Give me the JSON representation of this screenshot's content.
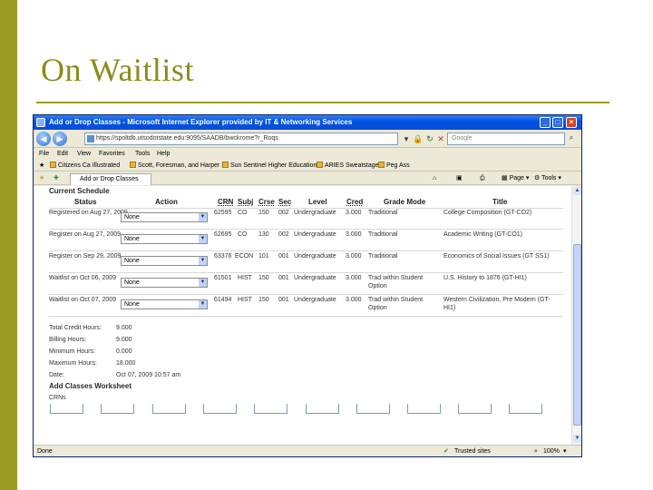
{
  "slide": {
    "title": "On Waitlist"
  },
  "window": {
    "title": "Add or Drop Classes - Microsoft Internet Explorer provided by IT & Networking Services",
    "address": "https://spoltdb.utsodotstate.edu:9095/SAADB/bwckrome?r_Roqs",
    "search_placeholder": "Google",
    "menu": [
      "File",
      "Edit",
      "View",
      "Favorites",
      "Tools",
      "Help"
    ],
    "links": [
      "Citizens Ca Illustrated",
      "Scott, Foresman, and Harper S",
      "Sun Sentinel Higher Education",
      "ARIES Sweatstage",
      "Peg Ass"
    ],
    "tab_label": "Add or Drop Classes",
    "tab_tools": [
      "Page",
      "Tools"
    ],
    "status_left": "Done",
    "status_zone": "Trusted sites",
    "status_zoom": "100%"
  },
  "schedule": {
    "heading": "Current Schedule",
    "columns": [
      "Status",
      "Action",
      "CRN",
      "Subj",
      "Crse",
      "Sec",
      "Level",
      "Cred",
      "Grade Mode",
      "Title"
    ],
    "rows": [
      {
        "status": "Registered on Aug 27, 2009",
        "action": "None",
        "crn": "62595",
        "subj": "CO",
        "crse": "150",
        "sec": "002",
        "level": "Undergraduate",
        "cred": "3.000",
        "grade_mode": "Traditional",
        "title": "College Composition (GT-CO2)"
      },
      {
        "status": "Register on Aug 27, 2009",
        "action": "None",
        "crn": "62695",
        "subj": "CO",
        "crse": "130",
        "sec": "002",
        "level": "Undergraduate",
        "cred": "3.000",
        "grade_mode": "Traditional",
        "title": "Academic Writing (GT-CO1)"
      },
      {
        "status": "Register on Sep 29, 2009",
        "action": "None",
        "crn": "63376",
        "subj": "ECON",
        "crse": "101",
        "sec": "001",
        "level": "Undergraduate",
        "cred": "3.000",
        "grade_mode": "Traditional",
        "title": "Economics of Social Issues (GT SS1)"
      },
      {
        "status": "Waitlist on Oct 06, 2009",
        "action": "None",
        "crn": "61501",
        "subj": "HIST",
        "crse": "150",
        "sec": "001",
        "level": "Undergraduate",
        "cred": "3.000",
        "grade_mode": "Trad within Student Option",
        "title": "U.S. History to 1876 (GT-HI1)"
      },
      {
        "status": "Waitlist on Oct 07, 2009",
        "action": "None",
        "crn": "61494",
        "subj": "HIST",
        "crse": "150",
        "sec": "001",
        "level": "Undergraduate",
        "cred": "3.000",
        "grade_mode": "Trad within Student Option",
        "title": "Western Civilization, Pre Modern (GT-HI1)"
      }
    ]
  },
  "summary": [
    {
      "label": "Total Credit Hours:",
      "value": "9.000"
    },
    {
      "label": "Billing Hours:",
      "value": "9.000"
    },
    {
      "label": "Minimum Hours:",
      "value": "0.000"
    },
    {
      "label": "Maximum Hours:",
      "value": "18.000"
    },
    {
      "label": "Date:",
      "value": "Oct 07, 2009 10:57 am"
    }
  ],
  "worksheet": {
    "heading": "Add Classes Worksheet",
    "crns_label": "CRNs"
  }
}
